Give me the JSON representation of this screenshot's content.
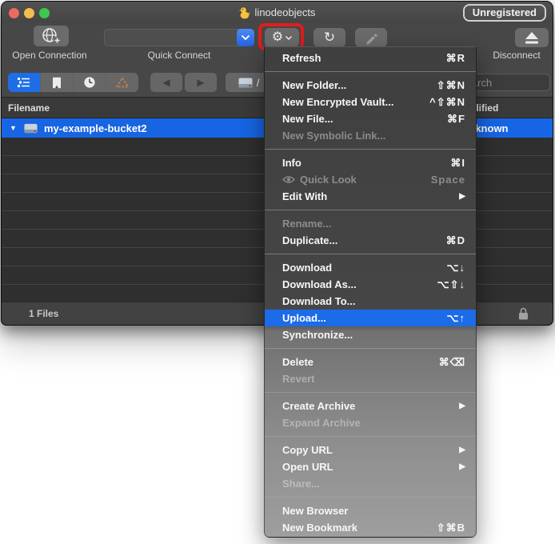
{
  "window": {
    "title": "linodeobjects",
    "badge": "Unregistered"
  },
  "toolbar": {
    "open_connection_label": "Open Connection",
    "quick_connect_label": "Quick Connect",
    "disconnect_label": "Disconnect"
  },
  "toolbar2": {
    "path_slash": "/",
    "search_placeholder": "Search"
  },
  "browser": {
    "columns": {
      "filename": "Filename",
      "modified": "Modified"
    },
    "row": {
      "name": "my-example-bucket2",
      "modified": "Unknown"
    },
    "empty_row_count": 9,
    "status": "1 Files"
  },
  "icons": {
    "gear": "⚙",
    "refresh": "↻",
    "back": "◀",
    "forward": "▶",
    "disclosure": "▼",
    "submenu_arrow": "▶"
  },
  "colors": {
    "selection_blue": "#1765e3",
    "menu_highlight_blue": "#1c6be8",
    "annotation_red": "#e01d1d",
    "accent_button_blue": "#2563e0"
  },
  "menu": {
    "sections": [
      [
        {
          "label": "Refresh",
          "shortcut": "⌘R"
        }
      ],
      [
        {
          "label": "New Folder...",
          "shortcut": "⇧⌘N"
        },
        {
          "label": "New Encrypted Vault...",
          "shortcut": "^⇧⌘N"
        },
        {
          "label": "New File...",
          "shortcut": "⌘F"
        },
        {
          "label": "New Symbolic Link...",
          "disabled": true
        }
      ],
      [
        {
          "label": "Info",
          "shortcut": "⌘I"
        },
        {
          "label": "Quick Look",
          "icon": "eye",
          "disabled": true,
          "shortcut": "Space"
        },
        {
          "label": "Edit With",
          "submenu": true
        }
      ],
      [
        {
          "label": "Rename...",
          "disabled": true
        },
        {
          "label": "Duplicate...",
          "shortcut": "⌘D"
        }
      ],
      [
        {
          "label": "Download",
          "shortcut": "⌥↓"
        },
        {
          "label": "Download As...",
          "shortcut": "⌥⇧↓"
        },
        {
          "label": "Download To..."
        },
        {
          "label": "Upload...",
          "shortcut": "⌥↑",
          "highlighted": true
        },
        {
          "label": "Synchronize..."
        }
      ],
      [
        {
          "label": "Delete",
          "shortcut": "⌘⌫"
        },
        {
          "label": "Revert",
          "disabled": true
        }
      ],
      [
        {
          "label": "Create Archive",
          "submenu": true
        },
        {
          "label": "Expand Archive",
          "disabled": true
        }
      ],
      [
        {
          "label": "Copy URL",
          "submenu": true
        },
        {
          "label": "Open URL",
          "submenu": true
        },
        {
          "label": "Share...",
          "disabled": true
        }
      ],
      [
        {
          "label": "New Browser"
        },
        {
          "label": "New Bookmark",
          "shortcut": "⇧⌘B"
        }
      ]
    ]
  }
}
